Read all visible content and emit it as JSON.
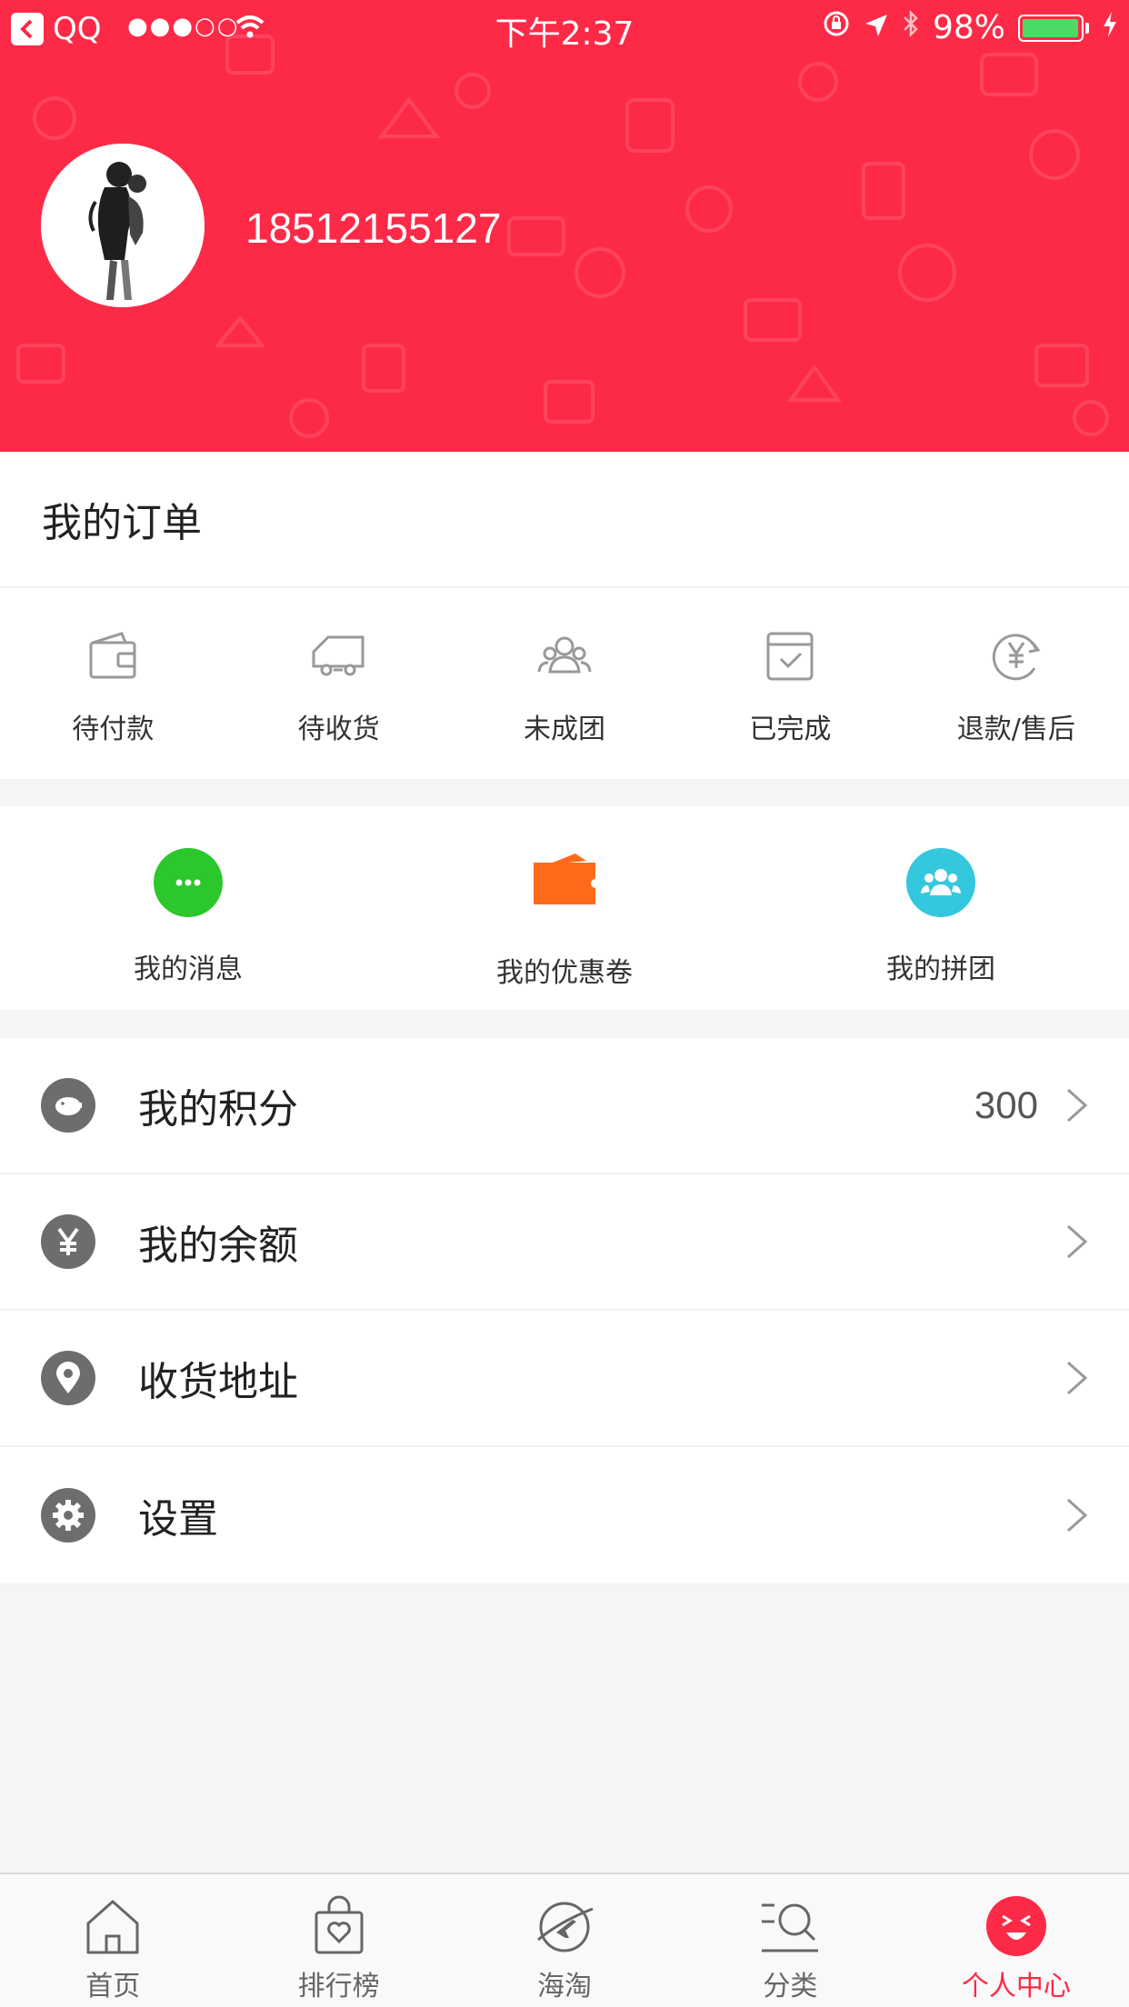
{
  "status_bar": {
    "back_app": "QQ",
    "time": "下午2:37",
    "battery": "98%",
    "battery_level": 0.98
  },
  "profile": {
    "username": "18512155127"
  },
  "orders": {
    "title": "我的订单",
    "items": [
      {
        "label": "待付款",
        "icon": "wallet-icon"
      },
      {
        "label": "待收货",
        "icon": "truck-icon"
      },
      {
        "label": "未成团",
        "icon": "group-icon"
      },
      {
        "label": "已完成",
        "icon": "calendar-check-icon"
      },
      {
        "label": "退款/售后",
        "icon": "refund-yen-icon"
      }
    ]
  },
  "tools": [
    {
      "label": "我的消息",
      "icon": "message-icon",
      "color": "#2bc72b"
    },
    {
      "label": "我的优惠卷",
      "icon": "coupon-icon",
      "color": "#ff6a1a"
    },
    {
      "label": "我的拼团",
      "icon": "team-icon",
      "color": "#33c8dd"
    }
  ],
  "menu": [
    {
      "label": "我的积分",
      "value": "300",
      "icon": "piggy-bank-icon"
    },
    {
      "label": "我的余额",
      "value": "",
      "icon": "yen-icon"
    },
    {
      "label": "收货地址",
      "value": "",
      "icon": "location-pin-icon"
    },
    {
      "label": "设置",
      "value": "",
      "icon": "gear-icon"
    }
  ],
  "tabbar": [
    {
      "label": "首页",
      "icon": "home-icon",
      "active": false
    },
    {
      "label": "排行榜",
      "icon": "shopping-bag-icon",
      "active": false
    },
    {
      "label": "海淘",
      "icon": "globe-plane-icon",
      "active": false
    },
    {
      "label": "分类",
      "icon": "category-search-icon",
      "active": false
    },
    {
      "label": "个人中心",
      "icon": "profile-face-icon",
      "active": true
    }
  ],
  "colors": {
    "brand": "#fd2a47",
    "background": "#f4f5f5",
    "menu_icon": "#6d6d6d"
  }
}
